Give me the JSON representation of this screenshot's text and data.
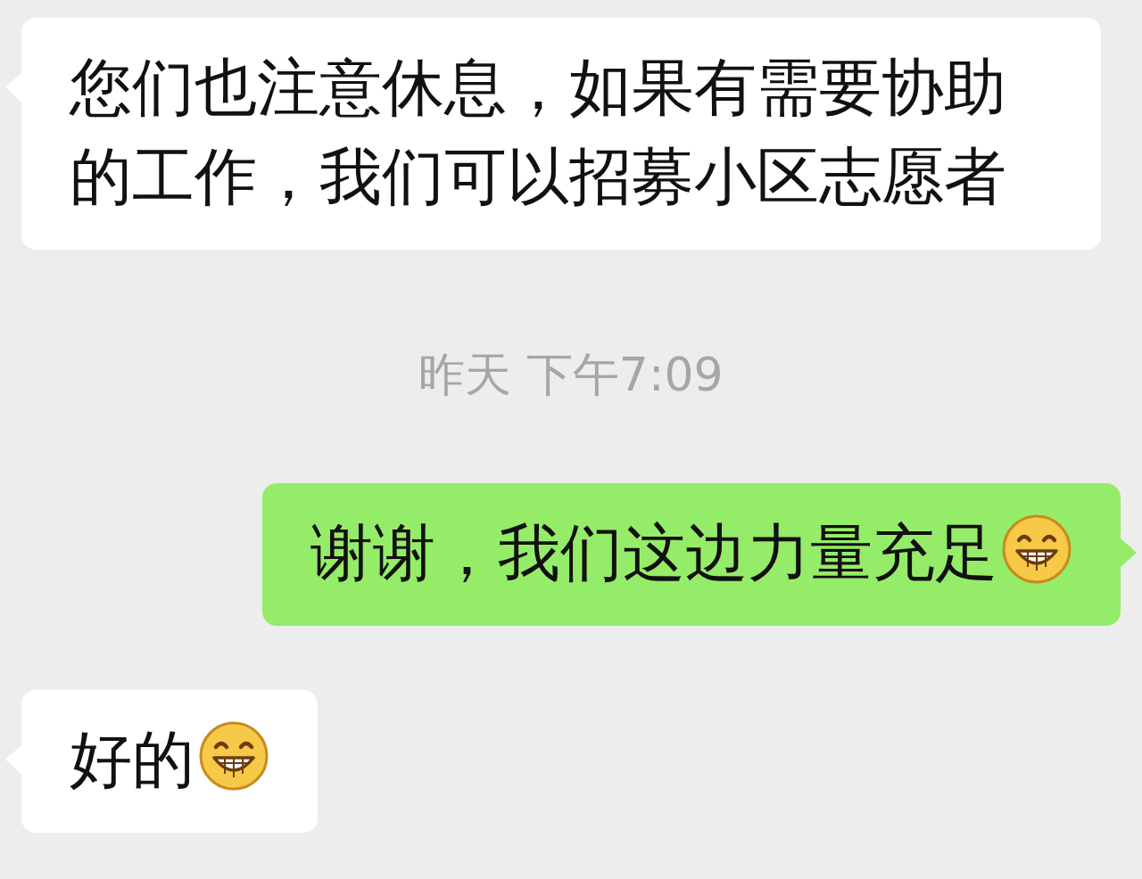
{
  "messages": [
    {
      "kind": "incoming",
      "text": "您们也注意休息，如果有需要协助的工作，我们可以招募小区志愿者",
      "emoji": false
    },
    {
      "kind": "timestamp",
      "text": "昨天 下午7:09"
    },
    {
      "kind": "outgoing",
      "text": "谢谢，我们这边力量充足",
      "emoji": true
    },
    {
      "kind": "incoming",
      "text": "好的",
      "emoji": true
    }
  ]
}
